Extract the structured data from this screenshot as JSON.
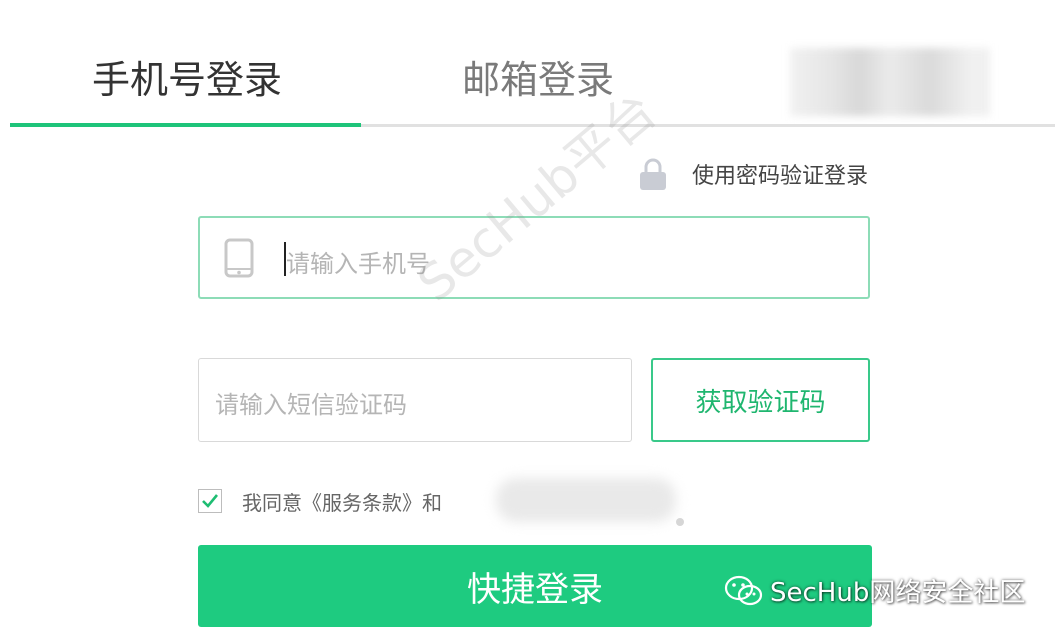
{
  "tabs": {
    "phone_login": "手机号登录",
    "email_login": "邮箱登录"
  },
  "password_login_link": "使用密码验证登录",
  "phone_input": {
    "placeholder": "请输入手机号",
    "value": ""
  },
  "sms_input": {
    "placeholder": "请输入短信验证码",
    "value": ""
  },
  "get_code_button": "获取验证码",
  "agreement": {
    "checked": true,
    "text": "我同意《服务条款》和"
  },
  "login_button": "快捷登录",
  "watermark": {
    "center": "SecHub平台",
    "bottom": "SecHub网络安全社区"
  },
  "colors": {
    "accent": "#1ecb80",
    "tab_underline": "#1ec47a",
    "input_focus_border": "#8ddcb7"
  },
  "icons": [
    "lock-icon",
    "phone-icon",
    "check-icon",
    "wechat-icon"
  ]
}
